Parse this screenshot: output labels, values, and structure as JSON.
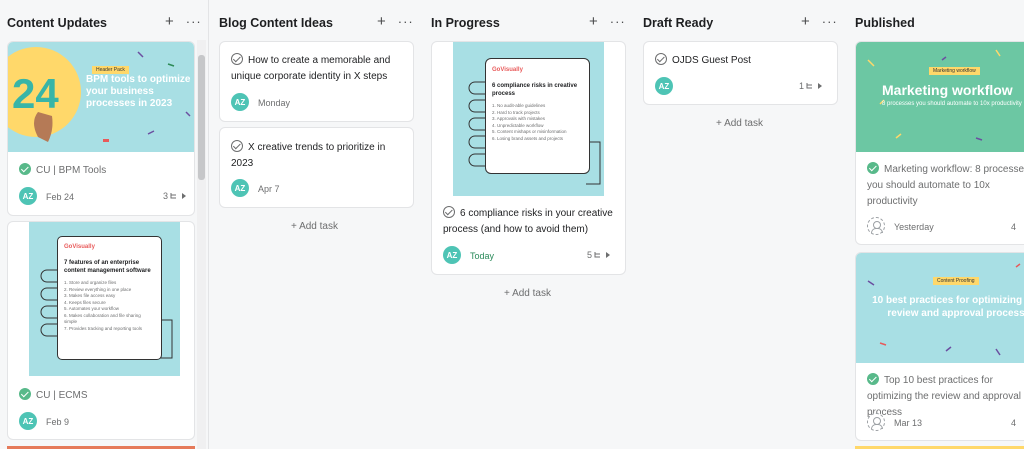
{
  "columns": [
    {
      "title": "Content Updates"
    },
    {
      "title": "Blog Content Ideas"
    },
    {
      "title": "In Progress"
    },
    {
      "title": "Draft Ready"
    },
    {
      "title": "Published"
    }
  ],
  "column_add_icon": "plus-icon",
  "column_more_icon": "more-icon",
  "add_task_label": "+ Add task",
  "cards": {
    "bpm": {
      "title": "CU | BPM Tools",
      "assignee": "AZ",
      "date": "Feb 24",
      "subtasks": "3",
      "cover": {
        "tag": "Header Pack",
        "number": "24",
        "headline": "BPM tools to optimize your business processes in 2023"
      }
    },
    "ecms": {
      "title": "CU | ECMS",
      "assignee": "AZ",
      "date": "Feb 9",
      "cover": {
        "brand": "GoVisually",
        "heading": "7 features of an enterprise content management software",
        "items": [
          "1. Store and organize files",
          "2. Review everything in one place",
          "3. Makes file access easy",
          "4. Keeps files secure",
          "5. Automates your workflow",
          "6. Makes collaboration and file sharing simple",
          "7. Provides tracking and reporting tools"
        ]
      }
    },
    "identity": {
      "title": "How to create a memorable and unique corporate identity in X steps",
      "assignee": "AZ",
      "date": "Monday"
    },
    "trends": {
      "title": "X creative trends to prioritize in 2023",
      "assignee": "AZ",
      "date": "Apr 7"
    },
    "compliance": {
      "title": "6 compliance risks in your creative process (and how to avoid them)",
      "assignee": "AZ",
      "date": "Today",
      "subtasks": "5",
      "cover": {
        "brand": "GoVisually",
        "heading": "6 compliance risks in creative process",
        "items": [
          "1. No audit-able guidelines",
          "2. Hard to track projects",
          "3. Approvals with mistakes",
          "4. Unpredictable workflow",
          "5. Content mishaps or misinformation",
          "6. Losing brand assets and projects"
        ]
      }
    },
    "ojds": {
      "title": "OJDS Guest Post",
      "assignee": "AZ",
      "subtasks": "1"
    },
    "marketing": {
      "title": "Marketing workflow: 8 processes you should automate to 10x productivity",
      "date": "Yesterday",
      "subtasks": "4",
      "cover": {
        "tag": "Marketing workflow",
        "headline": "Marketing workflow",
        "subhead": "8 processes you should automate to 10x productivity"
      }
    },
    "practices": {
      "title": "Top 10 best practices for optimizing the review and approval process",
      "date": "Mar 13",
      "subtasks": "4",
      "cover": {
        "tag": "Content Proofing",
        "headline": "10 best practices for optimizing the review and approval process"
      }
    }
  },
  "colors": {
    "teal": "#a8dfe4",
    "green": "#6cc7a3",
    "yellow": "#ffd86a",
    "accent": "#4ec4b5",
    "done": "#58b98a"
  }
}
